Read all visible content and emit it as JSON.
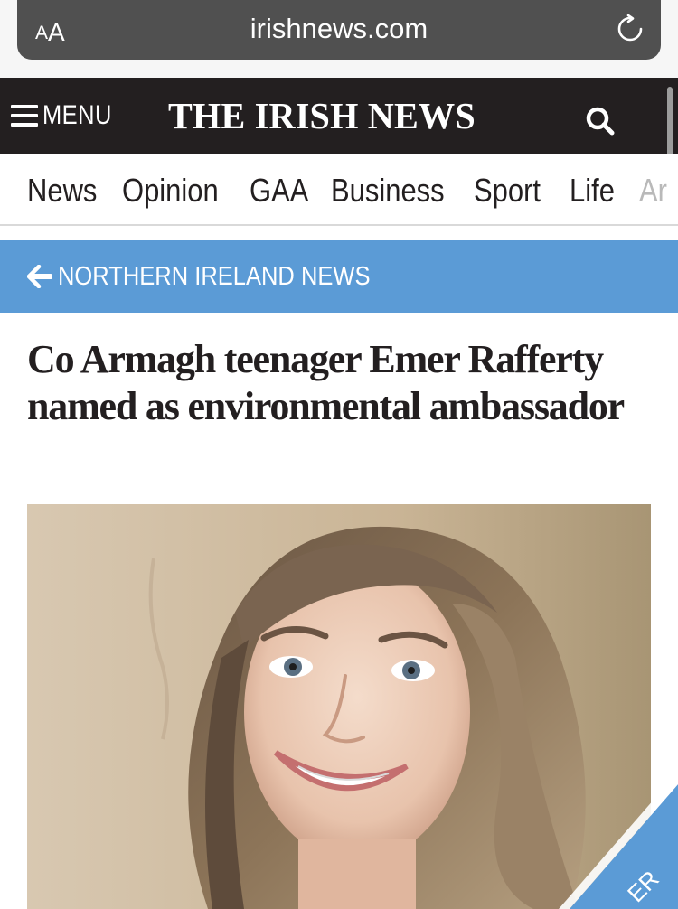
{
  "browser": {
    "aa_small": "A",
    "aa_large": "A",
    "url": "irishnews.com"
  },
  "masthead": {
    "menu_label": "MENU",
    "logo": "THE IRISH NEWS"
  },
  "nav": {
    "items": [
      "News",
      "Opinion",
      "GAA",
      "Business",
      "Sport",
      "Life",
      "Ar"
    ]
  },
  "breadcrumb": {
    "label": "NORTHERN IRELAND NEWS"
  },
  "article": {
    "headline": "Co Armagh teenager Emer Rafferty named as environmental ambassador"
  },
  "ribbon": {
    "text": "ER"
  },
  "colors": {
    "masthead_bg": "#231f20",
    "breadcrumb_bg": "#5b9bd6",
    "ribbon_bg": "#5b9bd6"
  },
  "icons": [
    "aa-text-size-icon",
    "reload-icon",
    "hamburger-menu-icon",
    "search-icon",
    "back-arrow-icon"
  ]
}
